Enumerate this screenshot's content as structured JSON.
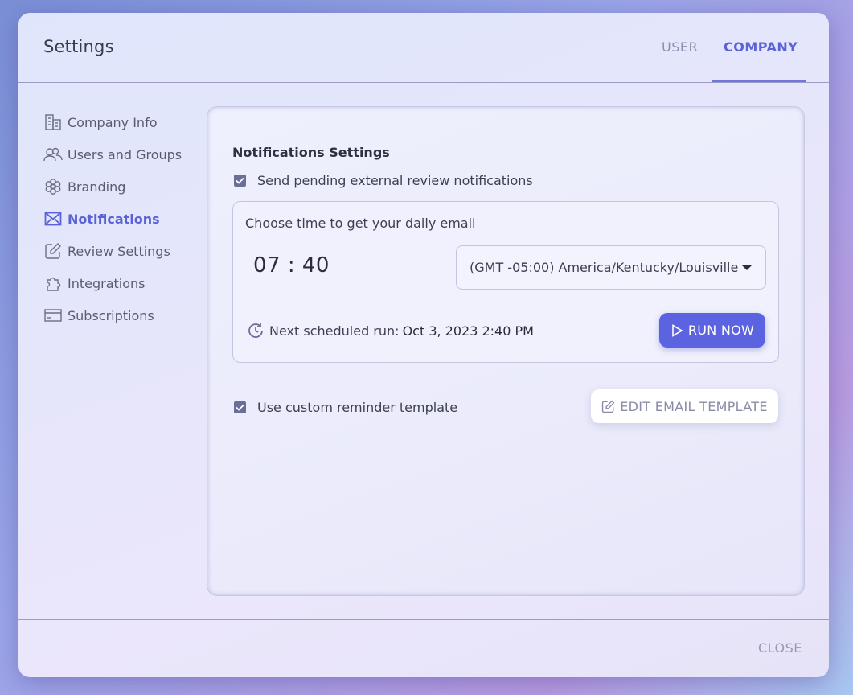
{
  "header": {
    "title": "Settings",
    "tabs": [
      {
        "label": "USER",
        "active": false
      },
      {
        "label": "COMPANY",
        "active": true
      }
    ]
  },
  "sidebar": {
    "items": [
      {
        "label": "Company Info",
        "icon": "building-icon",
        "active": false
      },
      {
        "label": "Users and Groups",
        "icon": "users-icon",
        "active": false
      },
      {
        "label": "Branding",
        "icon": "flower-icon",
        "active": false
      },
      {
        "label": "Notifications",
        "icon": "mail-icon",
        "active": true
      },
      {
        "label": "Review Settings",
        "icon": "edit-icon",
        "active": false
      },
      {
        "label": "Integrations",
        "icon": "puzzle-icon",
        "active": false
      },
      {
        "label": "Subscriptions",
        "icon": "card-icon",
        "active": false
      }
    ]
  },
  "panel": {
    "title": "Notifications Settings",
    "send_pending_label": "Send pending external review notifications",
    "send_pending_checked": true,
    "time_box": {
      "label": "Choose time to get your daily email",
      "time": "07 : 40",
      "timezone": "(GMT -05:00) America/Kentucky/Louisville",
      "next_run_label": "Next scheduled run:",
      "next_run_value": "Oct 3, 2023 2:40 PM",
      "run_now_label": "RUN NOW"
    },
    "custom_template_label": "Use custom reminder template",
    "custom_template_checked": true,
    "edit_template_label": "EDIT EMAIL TEMPLATE"
  },
  "footer": {
    "close_label": "CLOSE"
  },
  "colors": {
    "accent": "#5b63e0",
    "active_text": "#5a62d8",
    "checkbox": "#6b6e98"
  }
}
